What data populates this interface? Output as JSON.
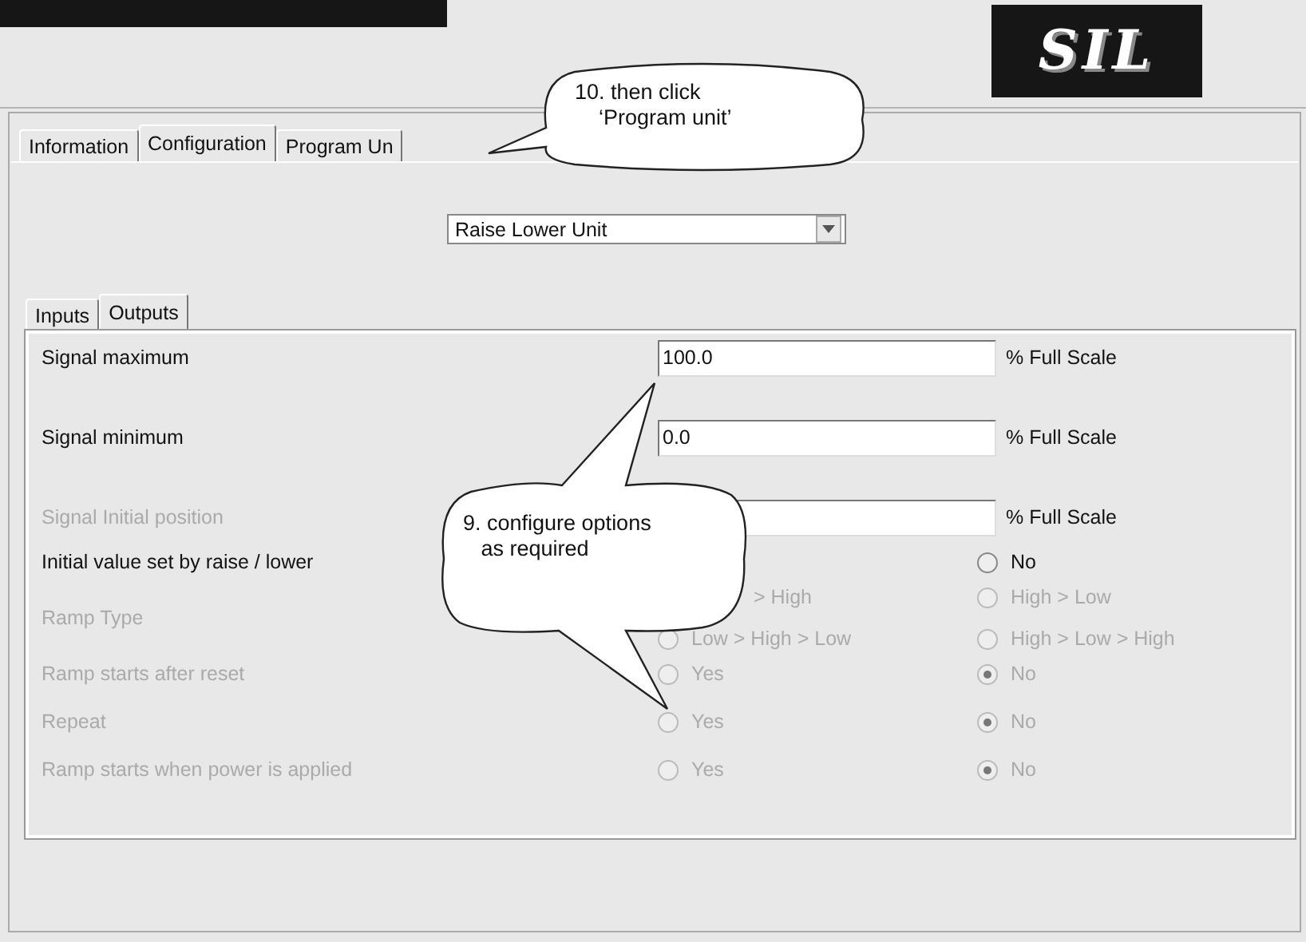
{
  "logo": "SIL",
  "tabs": [
    {
      "label": "Information",
      "selected": false
    },
    {
      "label": "Configuration",
      "selected": true
    },
    {
      "label": "Program Un",
      "selected": false
    }
  ],
  "unit_dropdown": {
    "value": "Raise Lower Unit"
  },
  "subtabs": [
    {
      "label": "Inputs",
      "selected": false
    },
    {
      "label": "Outputs",
      "selected": true
    }
  ],
  "rows": [
    {
      "kind": "field",
      "label": "Signal maximum",
      "disabled": false,
      "value": "100.0",
      "unit": "% Full Scale"
    },
    {
      "kind": "field",
      "label": "Signal minimum",
      "disabled": false,
      "value": "0.0",
      "unit": "% Full Scale"
    },
    {
      "kind": "field",
      "label": "Signal Initial position",
      "disabled": true,
      "unit": "% Full Scale"
    },
    {
      "kind": "radios",
      "label": "Initial value set by raise / lower",
      "disabled": false,
      "lines": [
        {
          "right": {
            "kind": "radio",
            "label": "No",
            "selected": false
          }
        }
      ]
    },
    {
      "kind": "radios",
      "label": "Ramp Type",
      "disabled": true,
      "lines": [
        {
          "left": {
            "kind": "covered",
            "label": "> High"
          },
          "right": {
            "kind": "radio",
            "label": "High > Low",
            "selected": false
          }
        },
        {
          "left": {
            "kind": "radio",
            "label": "Low > High > Low",
            "selected": false
          },
          "right": {
            "kind": "radio",
            "label": "High > Low > High",
            "selected": false
          }
        }
      ]
    },
    {
      "kind": "radios",
      "label": "Ramp starts after reset",
      "disabled": true,
      "lines": [
        {
          "left": {
            "kind": "radio",
            "label": "Yes",
            "selected": false
          },
          "right": {
            "kind": "radio",
            "label": "No",
            "selected": true
          }
        }
      ]
    },
    {
      "kind": "radios",
      "label": "Repeat",
      "disabled": true,
      "lines": [
        {
          "left": {
            "kind": "radio",
            "label": "Yes",
            "selected": false
          },
          "right": {
            "kind": "radio",
            "label": "No",
            "selected": true
          }
        }
      ]
    },
    {
      "kind": "radios",
      "label": "Ramp starts when power is applied",
      "disabled": true,
      "lines": [
        {
          "left": {
            "kind": "radio",
            "label": "Yes",
            "selected": false
          },
          "right": {
            "kind": "radio",
            "label": "No",
            "selected": true
          }
        }
      ]
    }
  ],
  "callouts": [
    {
      "text": "10. then click\n    ‘Program unit’"
    },
    {
      "text": "9. configure options\n   as required"
    }
  ]
}
